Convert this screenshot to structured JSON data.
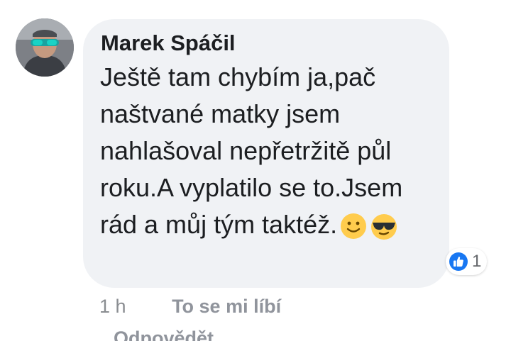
{
  "comment": {
    "author": "Marek Spáčil",
    "text": "Ještě tam chybím ja,pač naštvané matky jsem nahlašoval nepřetržitě půl roku.A vyplatilo se to.Jsem rád a můj tým taktéž.",
    "emojis": [
      "slightly-smiling-face-icon",
      "sunglasses-face-icon"
    ],
    "reaction_count": "1",
    "reaction_icon": "like-icon",
    "timestamp": "1 h",
    "like_label": "To se mi líbí",
    "reply_label": "Odpovědět"
  },
  "colors": {
    "bubble": "#f0f2f5",
    "like_blue": "#1877f2",
    "emoji_yellow": "#ffcc4d"
  }
}
